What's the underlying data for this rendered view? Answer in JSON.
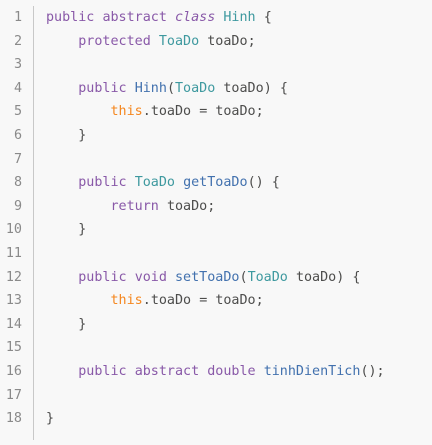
{
  "editor": {
    "lines": [
      {
        "num": "1",
        "indent": "",
        "tokens": [
          [
            "kw",
            "public"
          ],
          [
            "sp",
            " "
          ],
          [
            "kw",
            "abstract"
          ],
          [
            "sp",
            " "
          ],
          [
            "kw-it",
            "class"
          ],
          [
            "sp",
            " "
          ],
          [
            "type",
            "Hinh"
          ],
          [
            "sp",
            " "
          ],
          [
            "punct",
            "{"
          ]
        ]
      },
      {
        "num": "2",
        "indent": "    ",
        "tokens": [
          [
            "kw",
            "protected"
          ],
          [
            "sp",
            " "
          ],
          [
            "type",
            "ToaDo"
          ],
          [
            "sp",
            " "
          ],
          [
            "id",
            "toaDo"
          ],
          [
            "punct",
            ";"
          ]
        ]
      },
      {
        "num": "3",
        "indent": "",
        "tokens": []
      },
      {
        "num": "4",
        "indent": "    ",
        "tokens": [
          [
            "kw",
            "public"
          ],
          [
            "sp",
            " "
          ],
          [
            "fn",
            "Hinh"
          ],
          [
            "punct",
            "("
          ],
          [
            "type",
            "ToaDo"
          ],
          [
            "sp",
            " "
          ],
          [
            "id",
            "toaDo"
          ],
          [
            "punct",
            ")"
          ],
          [
            "sp",
            " "
          ],
          [
            "punct",
            "{"
          ]
        ]
      },
      {
        "num": "5",
        "indent": "        ",
        "tokens": [
          [
            "this",
            "this"
          ],
          [
            "punct",
            "."
          ],
          [
            "id",
            "toaDo"
          ],
          [
            "sp",
            " "
          ],
          [
            "punct",
            "="
          ],
          [
            "sp",
            " "
          ],
          [
            "id",
            "toaDo"
          ],
          [
            "punct",
            ";"
          ]
        ]
      },
      {
        "num": "6",
        "indent": "    ",
        "tokens": [
          [
            "punct",
            "}"
          ]
        ]
      },
      {
        "num": "7",
        "indent": "",
        "tokens": []
      },
      {
        "num": "8",
        "indent": "    ",
        "tokens": [
          [
            "kw",
            "public"
          ],
          [
            "sp",
            " "
          ],
          [
            "type",
            "ToaDo"
          ],
          [
            "sp",
            " "
          ],
          [
            "fn",
            "getToaDo"
          ],
          [
            "punct",
            "()"
          ],
          [
            "sp",
            " "
          ],
          [
            "punct",
            "{"
          ]
        ]
      },
      {
        "num": "9",
        "indent": "        ",
        "tokens": [
          [
            "kw",
            "return"
          ],
          [
            "sp",
            " "
          ],
          [
            "id",
            "toaDo"
          ],
          [
            "punct",
            ";"
          ]
        ]
      },
      {
        "num": "10",
        "indent": "    ",
        "tokens": [
          [
            "punct",
            "}"
          ]
        ]
      },
      {
        "num": "11",
        "indent": "",
        "tokens": []
      },
      {
        "num": "12",
        "indent": "    ",
        "tokens": [
          [
            "kw",
            "public"
          ],
          [
            "sp",
            " "
          ],
          [
            "kw",
            "void"
          ],
          [
            "sp",
            " "
          ],
          [
            "fn",
            "setToaDo"
          ],
          [
            "punct",
            "("
          ],
          [
            "type",
            "ToaDo"
          ],
          [
            "sp",
            " "
          ],
          [
            "id",
            "toaDo"
          ],
          [
            "punct",
            ")"
          ],
          [
            "sp",
            " "
          ],
          [
            "punct",
            "{"
          ]
        ]
      },
      {
        "num": "13",
        "indent": "        ",
        "tokens": [
          [
            "this",
            "this"
          ],
          [
            "punct",
            "."
          ],
          [
            "id",
            "toaDo"
          ],
          [
            "sp",
            " "
          ],
          [
            "punct",
            "="
          ],
          [
            "sp",
            " "
          ],
          [
            "id",
            "toaDo"
          ],
          [
            "punct",
            ";"
          ]
        ]
      },
      {
        "num": "14",
        "indent": "    ",
        "tokens": [
          [
            "punct",
            "}"
          ]
        ]
      },
      {
        "num": "15",
        "indent": "",
        "tokens": []
      },
      {
        "num": "16",
        "indent": "    ",
        "tokens": [
          [
            "kw",
            "public"
          ],
          [
            "sp",
            " "
          ],
          [
            "kw",
            "abstract"
          ],
          [
            "sp",
            " "
          ],
          [
            "kw",
            "double"
          ],
          [
            "sp",
            " "
          ],
          [
            "fn",
            "tinhDienTich"
          ],
          [
            "punct",
            "();"
          ]
        ]
      },
      {
        "num": "17",
        "indent": "",
        "tokens": []
      },
      {
        "num": "18",
        "indent": "",
        "tokens": [
          [
            "punct",
            "}"
          ]
        ]
      }
    ]
  }
}
